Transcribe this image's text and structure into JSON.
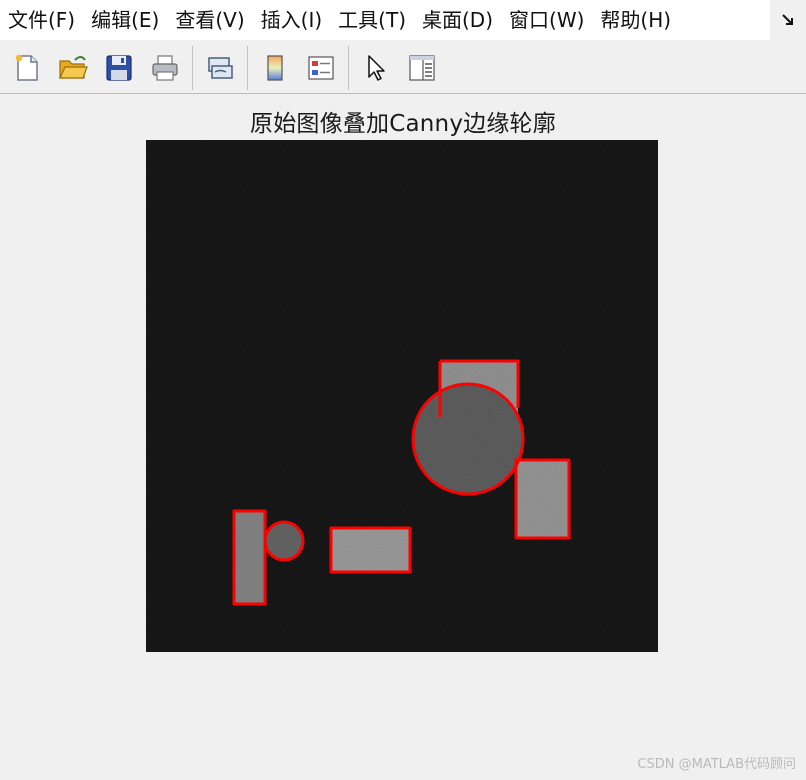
{
  "menubar": {
    "items": [
      "文件(F)",
      "编辑(E)",
      "查看(V)",
      "插入(I)",
      "工具(T)",
      "桌面(D)",
      "窗口(W)",
      "帮助(H)"
    ],
    "overflow_icon": "dock-arrow-icon"
  },
  "toolbar": {
    "buttons": [
      {
        "name": "new-figure-button",
        "icon": "new-file-icon"
      },
      {
        "name": "open-file-button",
        "icon": "folder-open-icon"
      },
      {
        "name": "save-figure-button",
        "icon": "floppy-disk-icon"
      },
      {
        "name": "print-figure-button",
        "icon": "printer-icon"
      },
      {
        "name": "link-plot-button",
        "icon": "link-plot-icon"
      },
      {
        "name": "insert-colorbar-button",
        "icon": "colorbar-icon"
      },
      {
        "name": "insert-legend-button",
        "icon": "legend-icon"
      },
      {
        "name": "edit-plot-button",
        "icon": "cursor-arrow-icon"
      },
      {
        "name": "property-editor-button",
        "icon": "property-panel-icon"
      }
    ]
  },
  "figure": {
    "title": "原始图像叠加Canny边缘轮廓",
    "image_background": "#0a0a0a",
    "edge_color": "#ff0000"
  },
  "watermark": "CSDN @MATLAB代码顾问"
}
